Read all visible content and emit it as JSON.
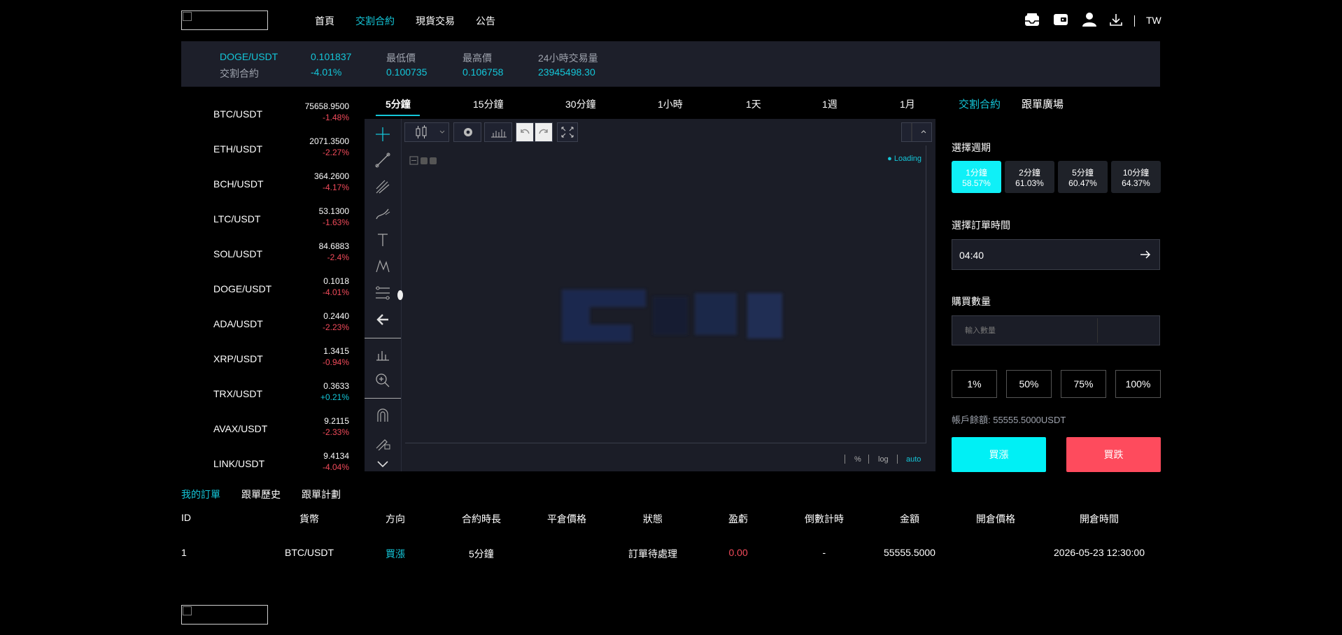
{
  "nav": {
    "items": [
      {
        "label": "首頁",
        "active": false
      },
      {
        "label": "交割合約",
        "active": true
      },
      {
        "label": "現貨交易",
        "active": false
      },
      {
        "label": "公告",
        "active": false
      }
    ],
    "lang": "TW"
  },
  "ticker": {
    "pair": "DOGE/USDT",
    "market": "交割合約",
    "price": "0.101837",
    "change": "-4.01%",
    "low_label": "最低價",
    "low": "0.100735",
    "high_label": "最高價",
    "high": "0.106758",
    "vol_label": "24小時交易量",
    "vol": "23945498.30"
  },
  "coins": [
    {
      "name": "BTC/USDT",
      "price": "75658.9500",
      "change": "-1.48%",
      "up": false
    },
    {
      "name": "ETH/USDT",
      "price": "2071.3500",
      "change": "-2.27%",
      "up": false
    },
    {
      "name": "BCH/USDT",
      "price": "364.2600",
      "change": "-4.17%",
      "up": false
    },
    {
      "name": "LTC/USDT",
      "price": "53.1300",
      "change": "-1.63%",
      "up": false
    },
    {
      "name": "SOL/USDT",
      "price": "84.6883",
      "change": "-2.4%",
      "up": false
    },
    {
      "name": "DOGE/USDT",
      "price": "0.1018",
      "change": "-4.01%",
      "up": false
    },
    {
      "name": "ADA/USDT",
      "price": "0.2440",
      "change": "-2.23%",
      "up": false
    },
    {
      "name": "XRP/USDT",
      "price": "1.3415",
      "change": "-0.94%",
      "up": false
    },
    {
      "name": "TRX/USDT",
      "price": "0.3633",
      "change": "+0.21%",
      "up": true
    },
    {
      "name": "AVAX/USDT",
      "price": "9.2115",
      "change": "-2.33%",
      "up": false
    },
    {
      "name": "LINK/USDT",
      "price": "9.4134",
      "change": "-4.04%",
      "up": false
    }
  ],
  "timeframes": [
    "5分鐘",
    "15分鐘",
    "30分鐘",
    "1小時",
    "1天",
    "1週",
    "1月"
  ],
  "chart": {
    "loading": "Loading",
    "scale_pct": "%",
    "scale_log": "log",
    "scale_auto": "auto"
  },
  "panel": {
    "tab_contract": "交割合約",
    "tab_follow": "跟單廣場",
    "period_label": "選擇週期",
    "periods": [
      {
        "name": "1分鐘",
        "rate": "58.57%"
      },
      {
        "name": "2分鐘",
        "rate": "61.03%"
      },
      {
        "name": "5分鐘",
        "rate": "60.47%"
      },
      {
        "name": "10分鐘",
        "rate": "64.37%"
      }
    ],
    "time_label": "選擇訂單時間",
    "time_value": "04:40",
    "qty_label": "購買數量",
    "qty_placeholder": "輸入數量",
    "pcts": [
      "1%",
      "50%",
      "75%",
      "100%"
    ],
    "balance": "帳戶餘額: 55555.5000USDT",
    "buy_up": "買漲",
    "buy_down": "買跌"
  },
  "orders": {
    "tabs": [
      "我的訂單",
      "跟單歷史",
      "跟單計劃"
    ],
    "headers": [
      "ID",
      "貨幣",
      "方向",
      "合約時長",
      "平倉價格",
      "狀態",
      "盈虧",
      "倒數計時",
      "金額",
      "開倉價格",
      "開倉時間"
    ],
    "rows": [
      [
        "1",
        "BTC/USDT",
        "買漲",
        "5分鐘",
        "",
        "訂單待處理",
        "0.00",
        "-",
        "55555.5000",
        "",
        "2026-05-23 12:30:00"
      ]
    ]
  },
  "colors": {
    "accent": "#14c6d8",
    "down": "#f24b5b",
    "buy": "#00f0f5",
    "sell": "#fe4b5d"
  }
}
